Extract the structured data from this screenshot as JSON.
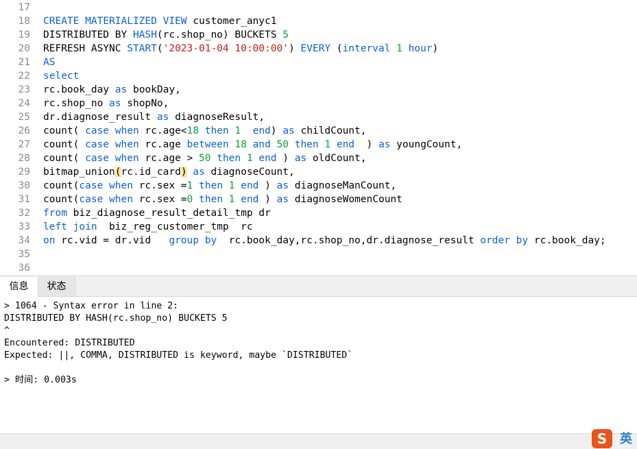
{
  "editor": {
    "lines": [
      {
        "n": "17",
        "tokens": []
      },
      {
        "n": "18",
        "tokens": [
          [
            "kw",
            "CREATE MATERIALIZED VIEW"
          ],
          [
            "t",
            " customer_anyc1"
          ]
        ]
      },
      {
        "n": "19",
        "tokens": [
          [
            "t",
            "DISTRIBUTED BY "
          ],
          [
            "kw",
            "HASH"
          ],
          [
            "t",
            "(rc.shop_no) BUCKETS "
          ],
          [
            "num",
            "5"
          ]
        ]
      },
      {
        "n": "20",
        "tokens": [
          [
            "t",
            "REFRESH ASYNC "
          ],
          [
            "kw",
            "START"
          ],
          [
            "t",
            "("
          ],
          [
            "str",
            "'2023-01-04 10:00:00'"
          ],
          [
            "t",
            ") "
          ],
          [
            "kw",
            "EVERY"
          ],
          [
            "t",
            " ("
          ],
          [
            "kw",
            "interval"
          ],
          [
            "t",
            " "
          ],
          [
            "num",
            "1"
          ],
          [
            "t",
            " "
          ],
          [
            "kw",
            "hour"
          ],
          [
            "t",
            ")"
          ]
        ]
      },
      {
        "n": "21",
        "tokens": [
          [
            "kw",
            "AS"
          ]
        ]
      },
      {
        "n": "22",
        "tokens": [
          [
            "kw",
            "select"
          ]
        ]
      },
      {
        "n": "23",
        "tokens": [
          [
            "t",
            "rc.book_day "
          ],
          [
            "kw",
            "as"
          ],
          [
            "t",
            " bookDay,"
          ]
        ]
      },
      {
        "n": "24",
        "tokens": [
          [
            "t",
            "rc.shop_no "
          ],
          [
            "kw",
            "as"
          ],
          [
            "t",
            " shopNo,"
          ]
        ]
      },
      {
        "n": "25",
        "tokens": [
          [
            "t",
            "dr.diagnose_result "
          ],
          [
            "kw",
            "as"
          ],
          [
            "t",
            " diagnoseResult,"
          ]
        ]
      },
      {
        "n": "26",
        "tokens": [
          [
            "t",
            "count( "
          ],
          [
            "kw",
            "case"
          ],
          [
            "t",
            " "
          ],
          [
            "kw",
            "when"
          ],
          [
            "t",
            " rc.age<"
          ],
          [
            "num",
            "18"
          ],
          [
            "t",
            " "
          ],
          [
            "kw",
            "then"
          ],
          [
            "t",
            " "
          ],
          [
            "num",
            "1"
          ],
          [
            "t",
            "  "
          ],
          [
            "kw",
            "end"
          ],
          [
            "t",
            ") "
          ],
          [
            "kw",
            "as"
          ],
          [
            "t",
            " childCount,"
          ]
        ]
      },
      {
        "n": "27",
        "tokens": [
          [
            "t",
            "count( "
          ],
          [
            "kw",
            "case"
          ],
          [
            "t",
            " "
          ],
          [
            "kw",
            "when"
          ],
          [
            "t",
            " rc.age "
          ],
          [
            "kw",
            "between"
          ],
          [
            "t",
            " "
          ],
          [
            "num",
            "18"
          ],
          [
            "t",
            " "
          ],
          [
            "kw",
            "and"
          ],
          [
            "t",
            " "
          ],
          [
            "num",
            "50"
          ],
          [
            "t",
            " "
          ],
          [
            "kw",
            "then"
          ],
          [
            "t",
            " "
          ],
          [
            "num",
            "1"
          ],
          [
            "t",
            " "
          ],
          [
            "kw",
            "end"
          ],
          [
            "t",
            "  ) "
          ],
          [
            "kw",
            "as"
          ],
          [
            "t",
            " youngCount,"
          ]
        ]
      },
      {
        "n": "28",
        "tokens": [
          [
            "t",
            "count( "
          ],
          [
            "kw",
            "case"
          ],
          [
            "t",
            " "
          ],
          [
            "kw",
            "when"
          ],
          [
            "t",
            " rc.age > "
          ],
          [
            "num",
            "50"
          ],
          [
            "t",
            " "
          ],
          [
            "kw",
            "then"
          ],
          [
            "t",
            " "
          ],
          [
            "num",
            "1"
          ],
          [
            "t",
            " "
          ],
          [
            "kw",
            "end"
          ],
          [
            "t",
            " ) "
          ],
          [
            "kw",
            "as"
          ],
          [
            "t",
            " oldCount,"
          ]
        ]
      },
      {
        "n": "29",
        "tokens": [
          [
            "t",
            "bitmap_union"
          ],
          [
            "hl",
            "("
          ],
          [
            "t",
            "rc.id_card"
          ],
          [
            "hl",
            ")"
          ],
          [
            "t",
            " "
          ],
          [
            "kw",
            "as"
          ],
          [
            "t",
            " diagnoseCount,"
          ]
        ]
      },
      {
        "n": "30",
        "tokens": [
          [
            "t",
            "count("
          ],
          [
            "kw",
            "case"
          ],
          [
            "t",
            " "
          ],
          [
            "kw",
            "when"
          ],
          [
            "t",
            " rc.sex ="
          ],
          [
            "num",
            "1"
          ],
          [
            "t",
            " "
          ],
          [
            "kw",
            "then"
          ],
          [
            "t",
            " "
          ],
          [
            "num",
            "1"
          ],
          [
            "t",
            " "
          ],
          [
            "kw",
            "end"
          ],
          [
            "t",
            " ) "
          ],
          [
            "kw",
            "as"
          ],
          [
            "t",
            " diagnoseManCount,"
          ]
        ]
      },
      {
        "n": "31",
        "tokens": [
          [
            "t",
            "count("
          ],
          [
            "kw",
            "case"
          ],
          [
            "t",
            " "
          ],
          [
            "kw",
            "when"
          ],
          [
            "t",
            " rc.sex ="
          ],
          [
            "num",
            "0"
          ],
          [
            "t",
            " "
          ],
          [
            "kw",
            "then"
          ],
          [
            "t",
            " "
          ],
          [
            "num",
            "1"
          ],
          [
            "t",
            " "
          ],
          [
            "kw",
            "end"
          ],
          [
            "t",
            " ) "
          ],
          [
            "kw",
            "as"
          ],
          [
            "t",
            " diagnoseWomenCount"
          ]
        ]
      },
      {
        "n": "32",
        "tokens": [
          [
            "kw",
            "from"
          ],
          [
            "t",
            " biz_diagnose_result_detail_tmp dr"
          ]
        ]
      },
      {
        "n": "33",
        "tokens": [
          [
            "kw",
            "left join"
          ],
          [
            "t",
            "  biz_reg_customer_tmp  rc"
          ]
        ]
      },
      {
        "n": "34",
        "tokens": [
          [
            "kw",
            "on"
          ],
          [
            "t",
            " rc.vid = dr.vid   "
          ],
          [
            "kw",
            "group by"
          ],
          [
            "t",
            "  rc.book_day,rc.shop_no,dr.diagnose_result "
          ],
          [
            "kw",
            "order by"
          ],
          [
            "t",
            " rc.book_day;"
          ]
        ]
      },
      {
        "n": "35",
        "tokens": []
      },
      {
        "n": "36",
        "tokens": []
      }
    ]
  },
  "tabs": {
    "info": "信息",
    "status": "状态"
  },
  "output": {
    "lines": [
      "> 1064 - Syntax error in line 2:",
      "DISTRIBUTED BY HASH(rc.shop_no) BUCKETS 5",
      "^",
      "Encountered: DISTRIBUTED",
      "Expected: ||, COMMA, DISTRIBUTED is keyword, maybe `DISTRIBUTED`",
      "",
      "> 时间: 0.003s"
    ]
  },
  "ime": {
    "logo_letter": "S",
    "language": "英"
  }
}
